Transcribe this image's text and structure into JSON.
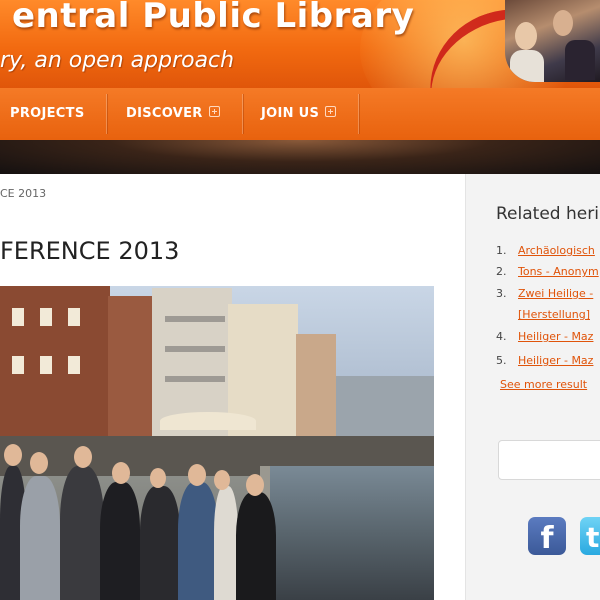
{
  "header": {
    "site_title": "entral Public Library",
    "tagline": "ry, an open approach"
  },
  "nav": {
    "items": [
      {
        "label": "PROJECTS",
        "has_submenu": false
      },
      {
        "label": "DISCOVER",
        "has_submenu": true
      },
      {
        "label": "JOIN US",
        "has_submenu": true
      }
    ]
  },
  "main": {
    "breadcrumb": "CE 2013",
    "heading": "FERENCE 2013"
  },
  "sidebar": {
    "title": "Related heri",
    "items": [
      {
        "num": "1.",
        "label": "Archäologisch"
      },
      {
        "num": "2.",
        "label": "Tons - Anonym"
      },
      {
        "num": "3.",
        "label": "Zwei Heilige -"
      },
      {
        "num": "",
        "label": "[Herstellung]"
      },
      {
        "num": "4.",
        "label": "Heiliger - Maz"
      },
      {
        "num": "5.",
        "label": "Heiliger - Maz"
      }
    ],
    "see_more": "See more result"
  },
  "colors": {
    "brand_orange": "#f26a10",
    "link_orange": "#e0540a",
    "facebook_blue": "#3b5998",
    "twitter_blue": "#2aa9e0"
  },
  "icons": {
    "facebook": "f",
    "twitter": "t"
  }
}
